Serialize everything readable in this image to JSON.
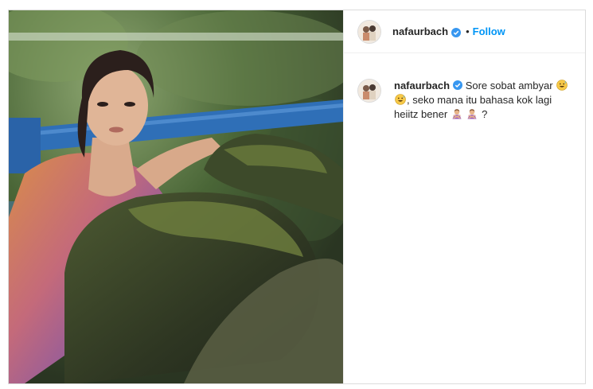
{
  "post": {
    "username": "nafaurbach",
    "header_separator": "•",
    "follow_label": "Follow",
    "caption_part1": "Sore sobat ambyar",
    "caption_part2": ", seko mana itu bahasa kok lagi heiitz bener",
    "caption_end": "?",
    "icons": {
      "verified": "verified-badge-icon",
      "emoji_1": "grinning-sweat-face",
      "emoji_2": "grinning-sweat-face",
      "emoji_3": "person-gesturing-no",
      "emoji_4": "person-gesturing-no"
    },
    "colors": {
      "follow": "#0095f6",
      "verified": "#3897f0",
      "text": "#262626"
    }
  }
}
